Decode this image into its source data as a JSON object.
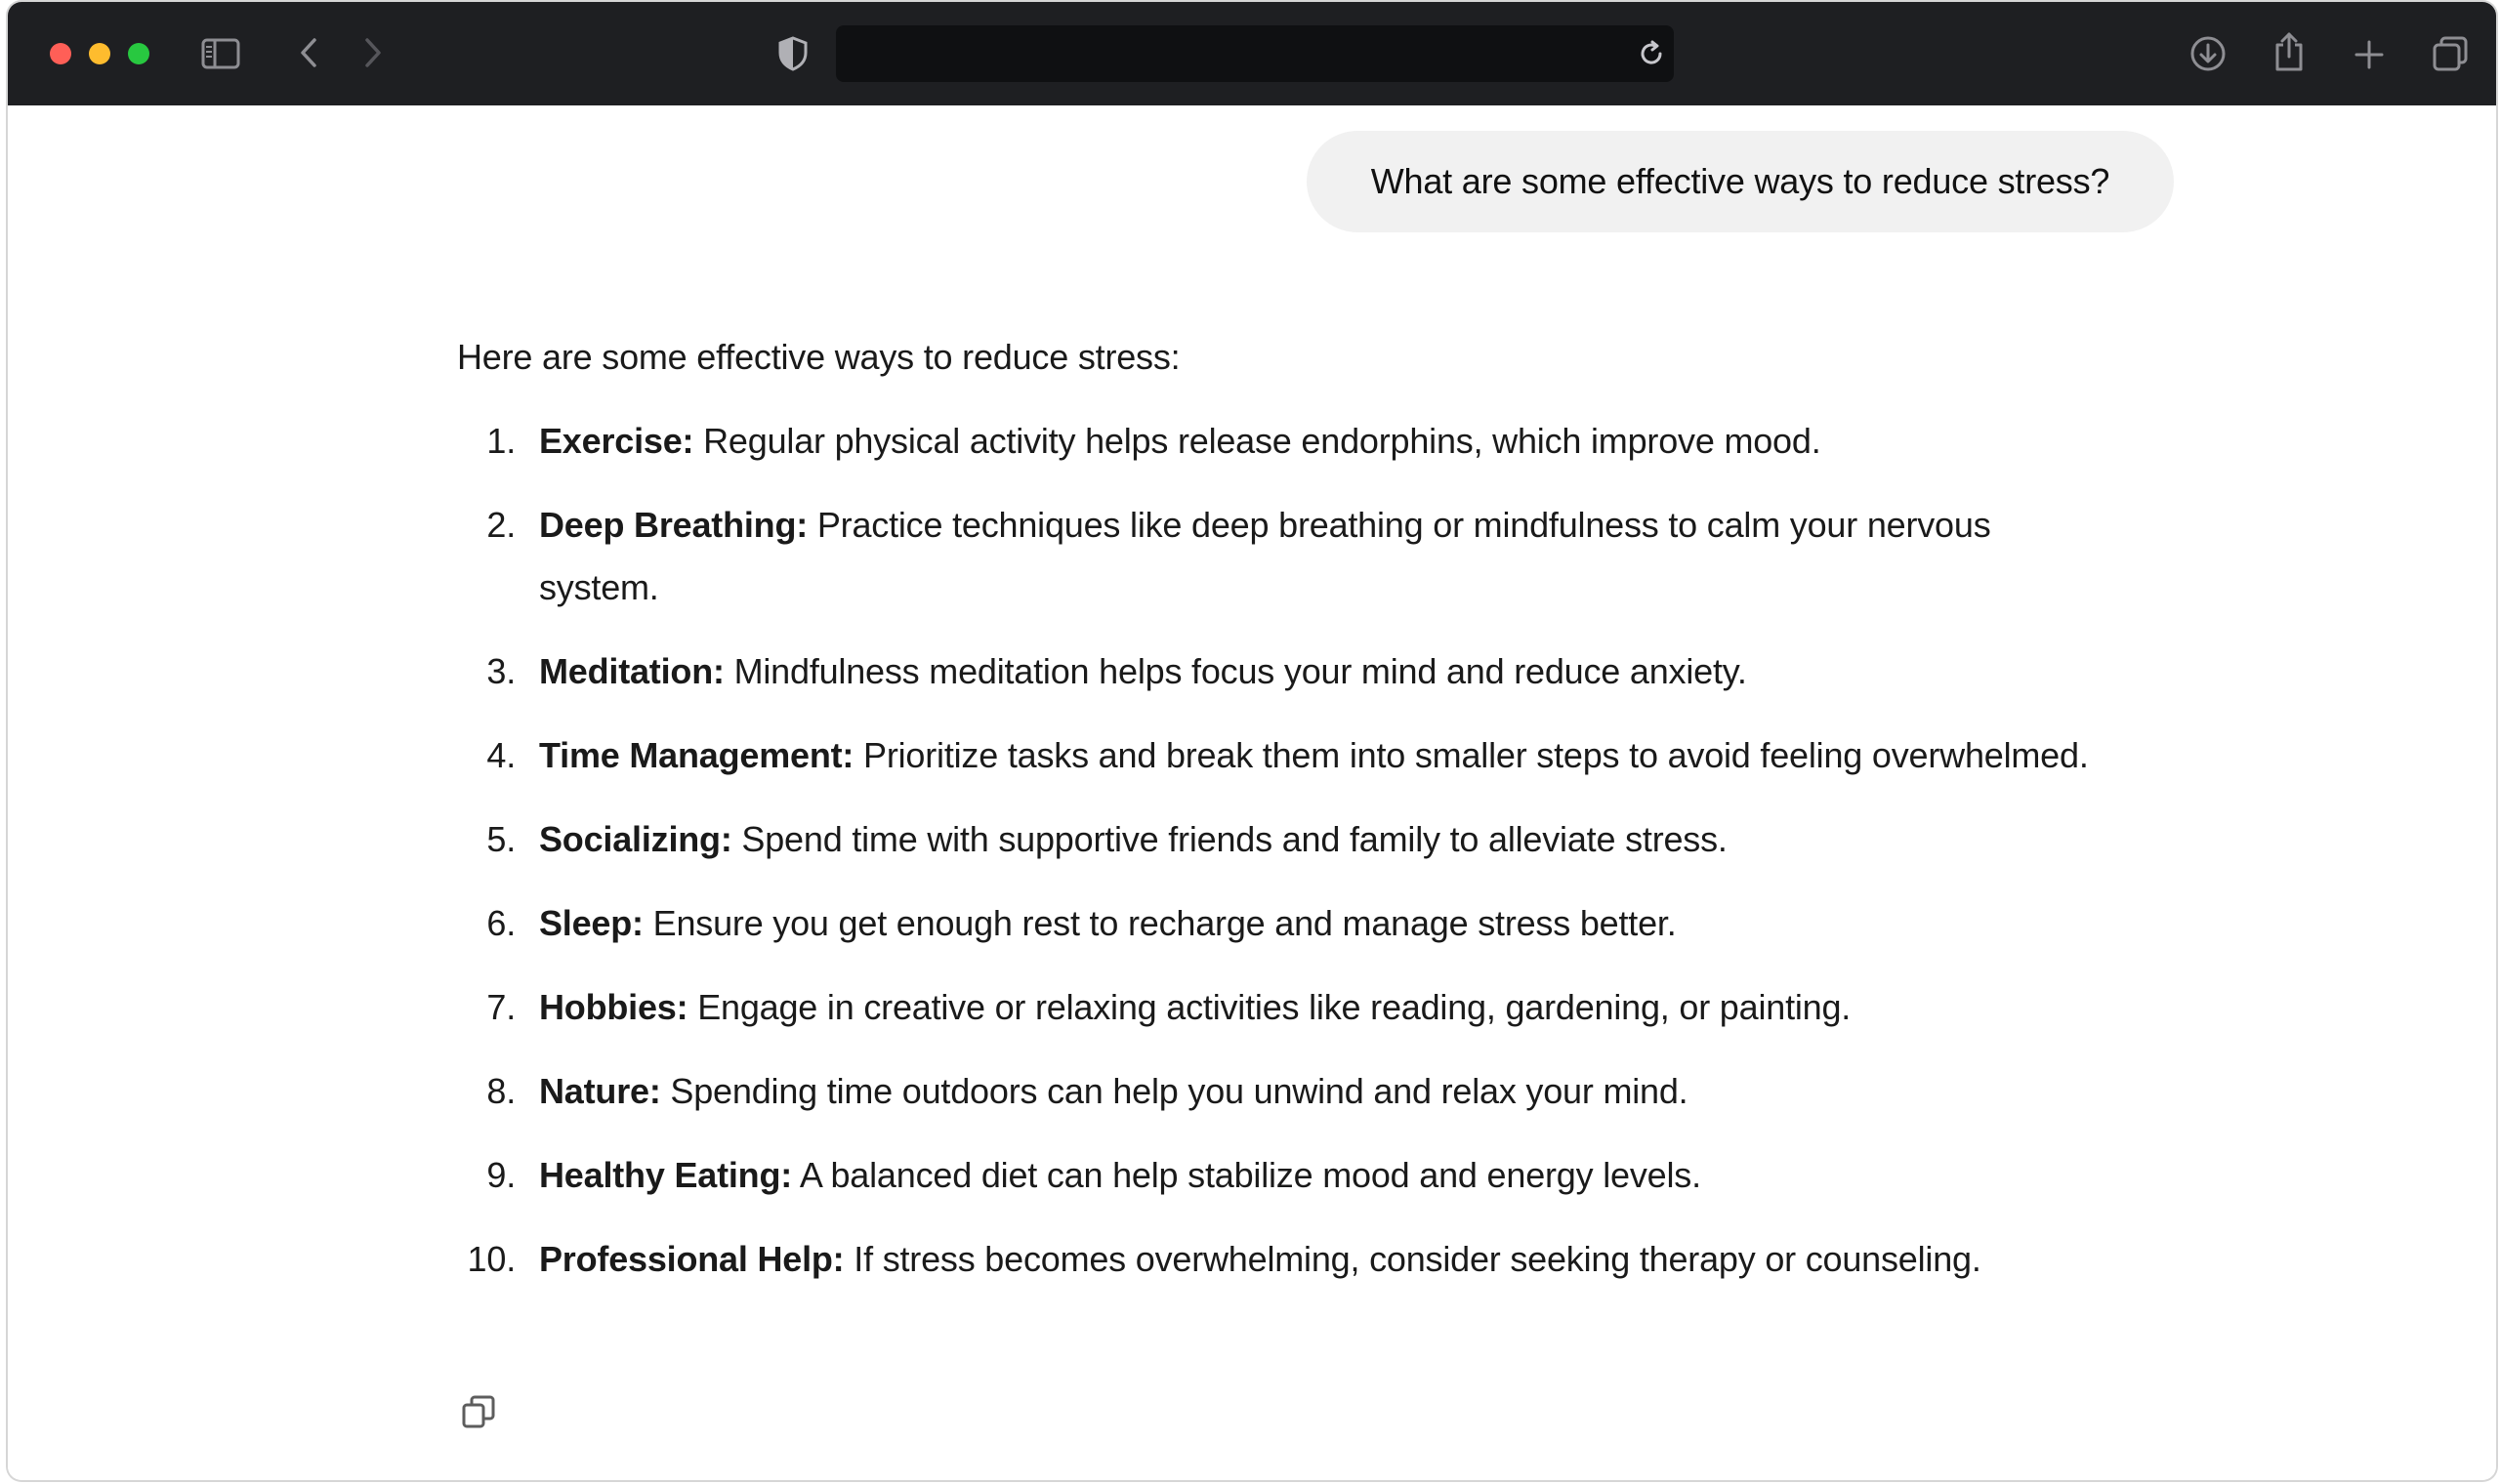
{
  "browser": {
    "window_controls": {
      "close_color": "#ff5f57",
      "minimize_color": "#febc2e",
      "maximize_color": "#28c840"
    },
    "address_bar_text": "",
    "icons": {
      "sidebar": "sidebar-icon",
      "back": "chevron-left-icon",
      "forward": "chevron-right-icon",
      "privacy": "shield-icon",
      "reload": "reload-icon",
      "downloads": "download-icon",
      "share": "share-icon",
      "new_tab": "plus-icon",
      "tab_overview": "tabs-icon"
    }
  },
  "chat": {
    "user_message": "What are some effective ways to reduce stress?",
    "assistant_intro": "Here are some effective ways to reduce stress:",
    "items": [
      {
        "num": "1.",
        "term": "Exercise:",
        "text": " Regular physical activity helps release endorphins, which improve mood."
      },
      {
        "num": "2.",
        "term": "Deep Breathing:",
        "text": " Practice techniques like deep breathing or mindfulness to calm your nervous system."
      },
      {
        "num": "3.",
        "term": "Meditation:",
        "text": " Mindfulness meditation helps focus your mind and reduce anxiety."
      },
      {
        "num": "4.",
        "term": "Time Management:",
        "text": " Prioritize tasks and break them into smaller steps to avoid feeling overwhelmed."
      },
      {
        "num": "5.",
        "term": "Socializing:",
        "text": " Spend time with supportive friends and family to alleviate stress."
      },
      {
        "num": "6.",
        "term": "Sleep:",
        "text": " Ensure you get enough rest to recharge and manage stress better."
      },
      {
        "num": "7.",
        "term": "Hobbies:",
        "text": " Engage in creative or relaxing activities like reading, gardening, or painting."
      },
      {
        "num": "8.",
        "term": "Nature:",
        "text": " Spending time outdoors can help you unwind and relax your mind."
      },
      {
        "num": "9.",
        "term": "Healthy Eating:",
        "text": " A balanced diet can help stabilize mood and energy levels."
      },
      {
        "num": "10.",
        "term": "Professional Help:",
        "text": " If stress becomes overwhelming, consider seeking therapy or counseling."
      }
    ],
    "copy_icon": "copy-icon"
  }
}
